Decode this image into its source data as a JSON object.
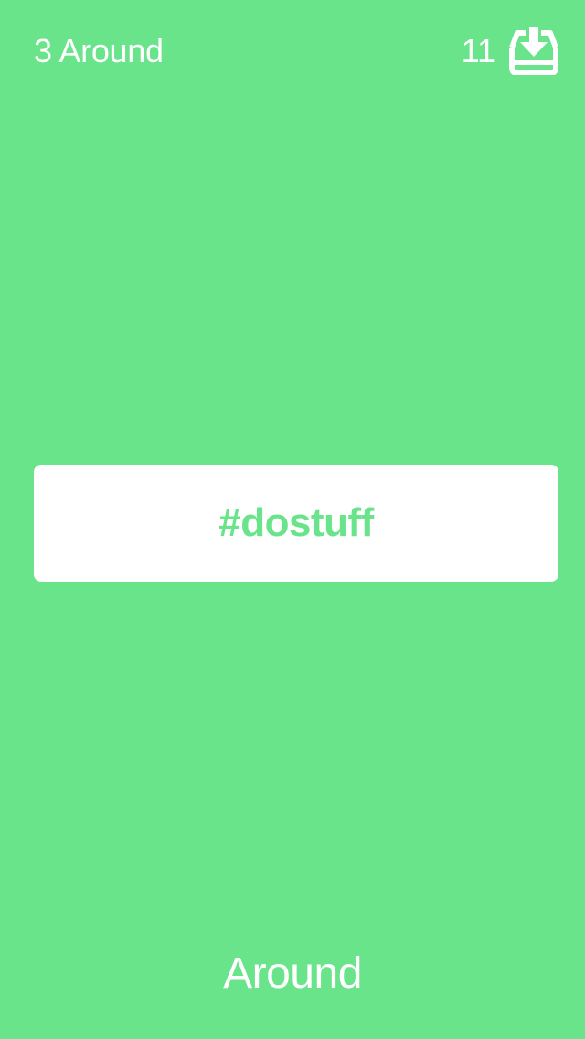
{
  "header": {
    "around_count_label": "3 Around",
    "inbox_count": "11",
    "inbox_icon": "inbox-download-icon"
  },
  "card": {
    "hashtag": "#dostuff"
  },
  "footer": {
    "mode_label": "Around"
  },
  "colors": {
    "background": "#69E48A",
    "card_background": "#FFFFFF",
    "accent_text": "#69E48A",
    "foreground": "#FFFFFF"
  }
}
